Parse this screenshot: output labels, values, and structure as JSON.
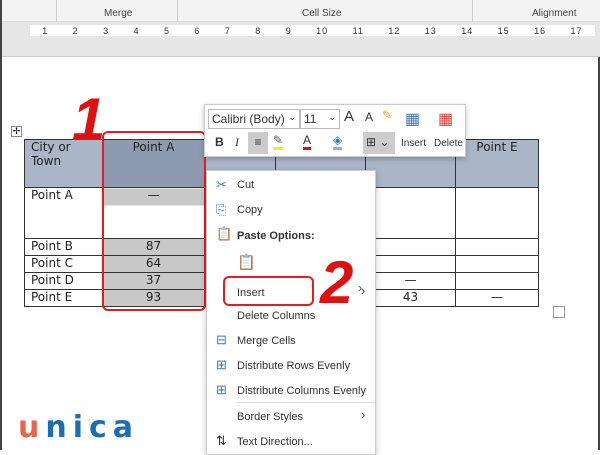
{
  "ribbon": {
    "groups": [
      "Merge",
      "Cell Size",
      "Alignment"
    ]
  },
  "ruler": {
    "marks": [
      "1",
      "2",
      "3",
      "4",
      "5",
      "6",
      "7",
      "8",
      "9",
      "10",
      "11",
      "12",
      "13",
      "14",
      "15",
      "16",
      "17"
    ]
  },
  "mini_toolbar": {
    "font": "Calibri (Body)",
    "size": "11",
    "insert": "Insert",
    "delete": "Delete",
    "bold": "B",
    "italic": "I"
  },
  "table": {
    "headers": [
      "City or Town",
      "Point A",
      "",
      "",
      "",
      "Point E"
    ],
    "rows": [
      [
        "Point A",
        "—",
        "",
        "",
        "",
        ""
      ],
      [
        "Point B",
        "87",
        "",
        "",
        "",
        ""
      ],
      [
        "Point C",
        "64",
        "",
        "",
        "",
        ""
      ],
      [
        "Point D",
        "37",
        "",
        "",
        "—",
        ""
      ],
      [
        "Point E",
        "93",
        "",
        "",
        "43",
        "—"
      ]
    ]
  },
  "annotations": {
    "step1": "1",
    "step2": "2"
  },
  "context_menu": {
    "cut": "Cut",
    "copy": "Copy",
    "paste_options": "Paste Options:",
    "insert": "Insert",
    "delete_columns": "Delete Columns",
    "merge_cells": "Merge Cells",
    "distribute_rows": "Distribute Rows Evenly",
    "distribute_columns": "Distribute Columns Evenly",
    "border_styles": "Border Styles",
    "text_direction": "Text Direction..."
  },
  "logo": "unica",
  "colors": {
    "accent": "#e02020",
    "header": "#aab6c8",
    "logo": "#1a6fb0",
    "logo_u": "#e8674a"
  }
}
